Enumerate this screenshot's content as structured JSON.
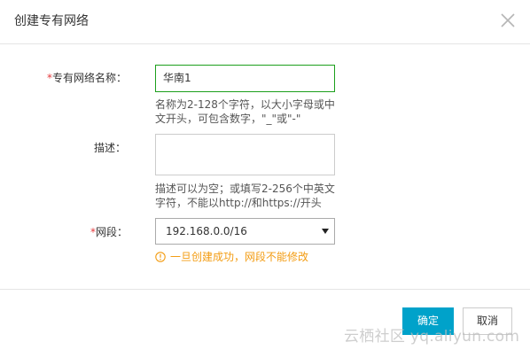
{
  "dialog": {
    "title": "创建专有网络"
  },
  "fields": {
    "name": {
      "required_mark": "*",
      "label": "专有网络名称：",
      "value": "华南1",
      "hint": "名称为2-128个字符，以大小字母或中文开头，可包含数字，\"_\"或\"-\""
    },
    "description": {
      "label": "描述：",
      "value": "",
      "hint": "描述可以为空；或填写2-256个中英文字符，不能以http://和https://开头"
    },
    "segment": {
      "required_mark": "*",
      "label": "网段：",
      "selected": "192.168.0.0/16",
      "warning": "一旦创建成功，网段不能修改"
    }
  },
  "buttons": {
    "ok": "确定",
    "cancel": "取消"
  },
  "watermark": "云栖社区 yq.aliyun.com",
  "colors": {
    "accent": "#00a2ca",
    "required": "#e4393c",
    "warning": "#f39c12",
    "focus_border": "#1c9f1c"
  }
}
